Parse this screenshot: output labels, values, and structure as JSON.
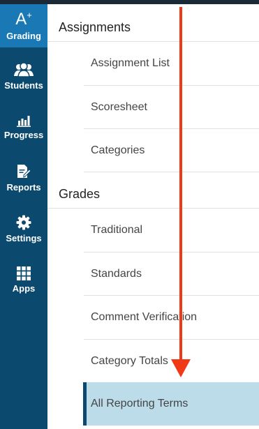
{
  "nav": {
    "items": [
      {
        "id": "grading",
        "label": "Grading",
        "icon": "a-plus-icon",
        "active": true
      },
      {
        "id": "students",
        "label": "Students",
        "icon": "students-icon"
      },
      {
        "id": "progress",
        "label": "Progress",
        "icon": "bar-chart-icon"
      },
      {
        "id": "reports",
        "label": "Reports",
        "icon": "report-edit-icon"
      },
      {
        "id": "settings",
        "label": "Settings",
        "icon": "gear-icon"
      },
      {
        "id": "apps",
        "label": "Apps",
        "icon": "grid-icon"
      }
    ],
    "grading_glyph": "A",
    "grading_glyph_sup": "+"
  },
  "menu": {
    "assignments_heading": "Assignments",
    "assignments": [
      "Assignment List",
      "Scoresheet",
      "Categories"
    ],
    "grades_heading": "Grades",
    "grades": [
      "Traditional",
      "Standards",
      "Comment Verification",
      "Category Totals",
      "All Reporting Terms"
    ],
    "selected": "All Reporting Terms"
  },
  "colors": {
    "nav_bg": "#0b4a6e",
    "nav_active": "#1a78b4",
    "selected_bg": "#bcdcea",
    "arrow": "#f03a17"
  }
}
